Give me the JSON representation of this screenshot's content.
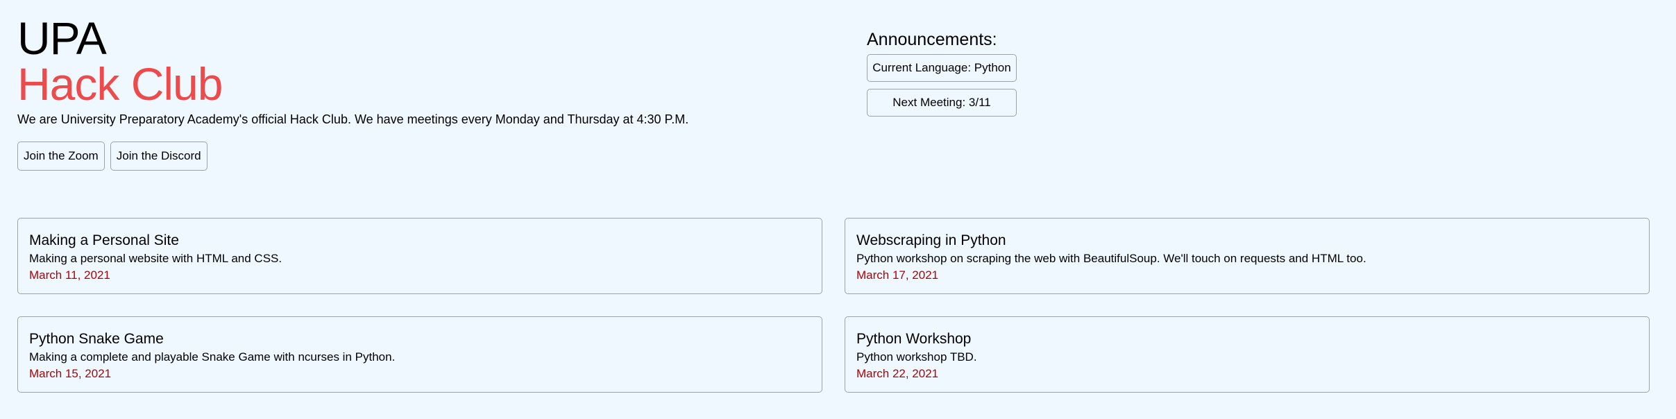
{
  "header": {
    "title_line1": "UPA",
    "title_line2": "Hack Club",
    "tagline": "We are University Preparatory Academy's official Hack Club. We have meetings every Monday and Thursday at 4:30 P.M.",
    "links": [
      {
        "label": "Join the Zoom"
      },
      {
        "label": "Join the Discord"
      }
    ]
  },
  "announcements": {
    "title": "Announcements:",
    "items": [
      {
        "text": "Current Language: Python"
      },
      {
        "text": "Next Meeting: 3/11"
      }
    ]
  },
  "workshops": [
    {
      "title": "Making a Personal Site",
      "description": "Making a personal website with HTML and CSS.",
      "date": "March 11, 2021"
    },
    {
      "title": "Webscraping in Python",
      "description": "Python workshop on scraping the web with BeautifulSoup. We'll touch on requests and HTML too.",
      "date": "March 17, 2021"
    },
    {
      "title": "Python Snake Game",
      "description": "Making a complete and playable Snake Game with ncurses in Python.",
      "date": "March 15, 2021"
    },
    {
      "title": "Python Workshop",
      "description": "Python workshop TBD.",
      "date": "March 22, 2021"
    }
  ],
  "colors": {
    "background": "#f0f8ff",
    "accent_red": "#ec4a4b",
    "date_red": "#b30000",
    "border": "#9aa3ad"
  }
}
